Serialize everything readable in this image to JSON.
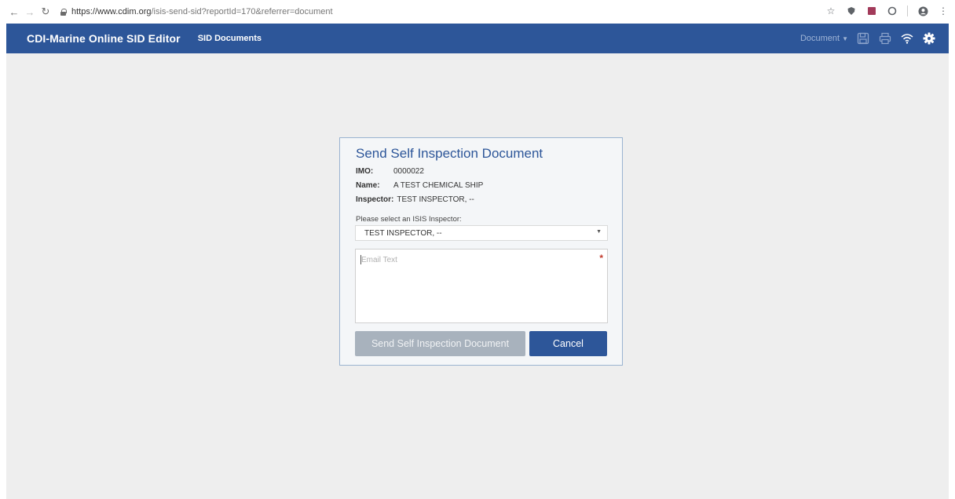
{
  "browser": {
    "url_host": "https://www.cdim.org",
    "url_path": "/isis-send-sid?reportId=170&referrer=document",
    "back_icon": "arrow-left-icon",
    "forward_icon": "arrow-right-icon",
    "reload_icon": "reload-icon"
  },
  "header": {
    "title": "CDI-Marine Online SID Editor",
    "nav_label": "SID Documents",
    "document_menu_label": "Document",
    "colors": {
      "bar": "#2d5699",
      "muted": "#9fb4d6"
    }
  },
  "dialog": {
    "title": "Send Self Inspection Document",
    "imo_label": "IMO:",
    "imo_value": "0000022",
    "name_label": "Name:",
    "name_value": "A TEST CHEMICAL SHIP",
    "inspector_label": "Inspector:",
    "inspector_value": "TEST INSPECTOR, --",
    "select_label": "Please select an ISIS Inspector:",
    "select_value": "TEST INSPECTOR, --",
    "email_placeholder": "Email Text",
    "required_mark": "*",
    "send_label": "Send Self Inspection Document",
    "cancel_label": "Cancel"
  }
}
